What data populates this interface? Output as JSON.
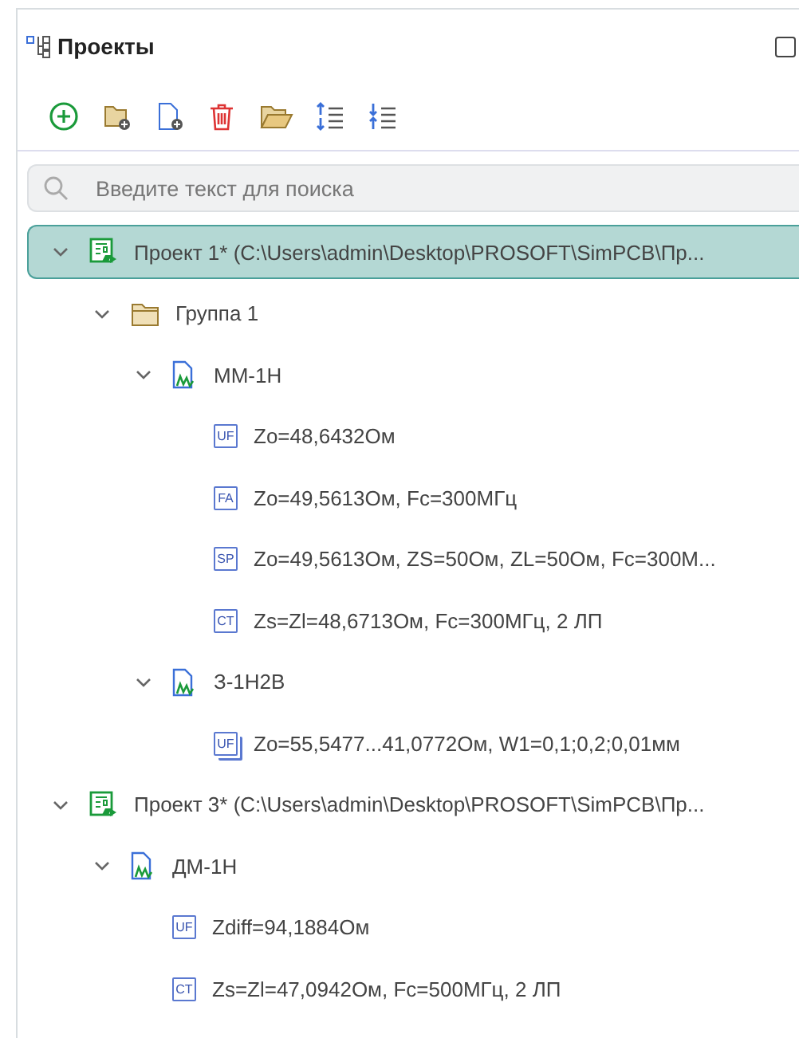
{
  "panel": {
    "title": "Проекты"
  },
  "search": {
    "placeholder": "Введите текст для поиска"
  },
  "tree": [
    {
      "kind": "project",
      "label": "Проект 1* (C:\\Users\\admin\\Desktop\\PROSOFT\\SimPCB\\Пр...",
      "selected": true,
      "expanded": true,
      "children": [
        {
          "kind": "group",
          "label": "Группа 1",
          "selected": false,
          "expanded": true,
          "children": [
            {
              "kind": "file",
              "label": "ММ-1Н",
              "selected": false,
              "expanded": true,
              "children": [
                {
                  "kind": "result",
                  "badge": "UF",
                  "label": "Zo=48,6432Ом",
                  "selected": false
                },
                {
                  "kind": "result",
                  "badge": "FA",
                  "label": "Zo=49,5613Ом, Fc=300МГц",
                  "selected": false
                },
                {
                  "kind": "result",
                  "badge": "SP",
                  "label": "Zo=49,5613Ом, ZS=50Ом, ZL=50Ом, Fc=300М...",
                  "selected": false
                },
                {
                  "kind": "result",
                  "badge": "CT",
                  "label": "Zs=Zl=48,6713Ом, Fc=300МГц, 2 ЛП",
                  "selected": false
                }
              ]
            },
            {
              "kind": "file",
              "label": "З-1Н2В",
              "selected": false,
              "expanded": true,
              "children": [
                {
                  "kind": "sweep",
                  "badge": "UF",
                  "label": "Zo=55,5477...41,0772Ом, W1=0,1;0,2;0,01мм",
                  "selected": false
                }
              ]
            }
          ]
        }
      ]
    },
    {
      "kind": "project",
      "label": "Проект 3* (C:\\Users\\admin\\Desktop\\PROSOFT\\SimPCB\\Пр...",
      "selected": false,
      "expanded": true,
      "children": [
        {
          "kind": "file",
          "label": "ДМ-1Н",
          "selected": false,
          "expanded": true,
          "children": [
            {
              "kind": "result",
              "badge": "UF",
              "label": "Zdiff=94,1884Ом",
              "selected": false
            },
            {
              "kind": "result",
              "badge": "CT",
              "label": "Zs=Zl=47,0942Ом, Fc=500МГц, 2 ЛП",
              "selected": false
            }
          ]
        }
      ]
    }
  ]
}
